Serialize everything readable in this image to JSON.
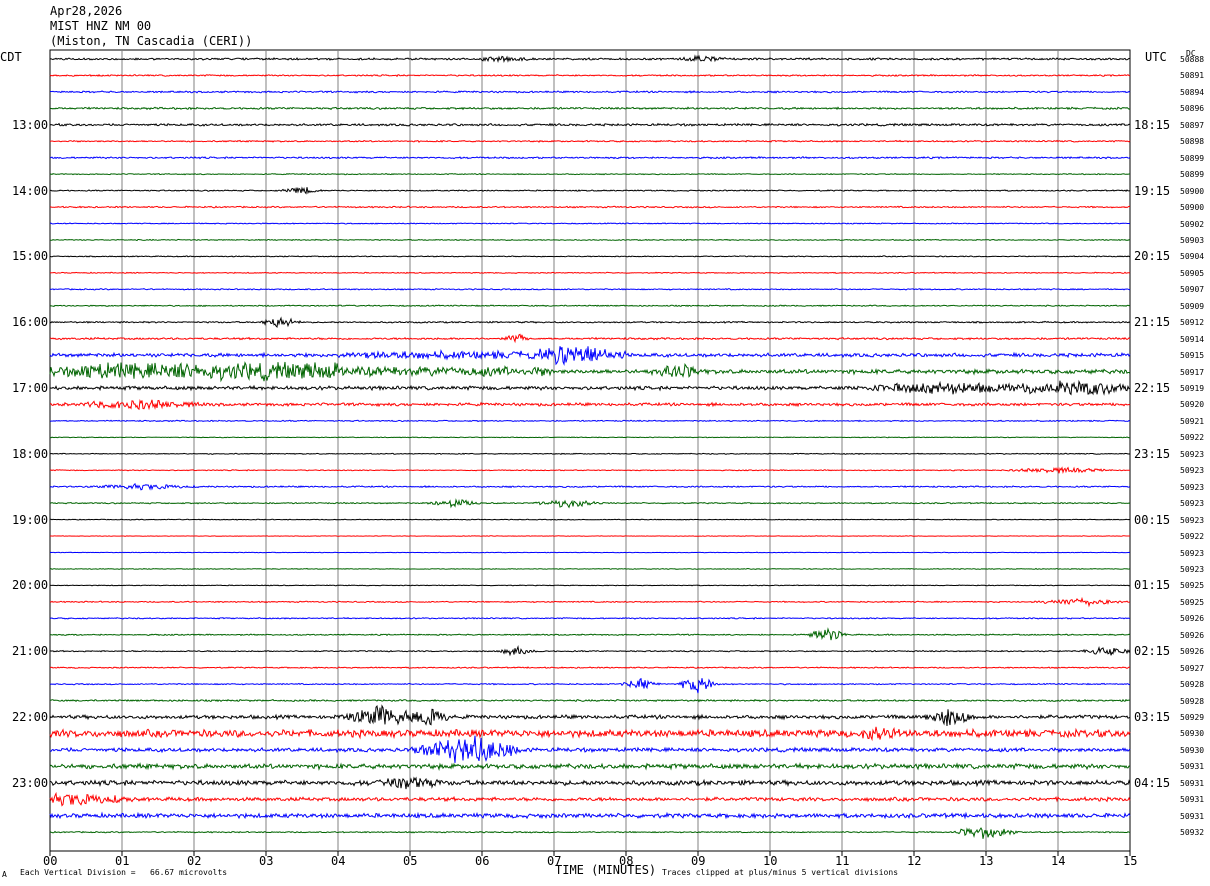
{
  "header": {
    "date": "Apr28,2026",
    "station": "MIST HNZ NM 00",
    "location": "(Miston, TN Cascadia (CERI))"
  },
  "axes": {
    "left_tz": "CDT",
    "right_tz": "UTC",
    "dc_label": "DC",
    "xlabel": "TIME (MINUTES)"
  },
  "footer": {
    "marker": "A",
    "scale_note": "Each Vertical Division =   66.67 microvolts",
    "clip_note": "Traces clipped at plus/minus 5 vertical divisions"
  },
  "colors": {
    "trace_cycle": [
      "#000000",
      "#ff0000",
      "#0000ff",
      "#006400"
    ],
    "grid": "#808080"
  },
  "chart_data": {
    "type": "line",
    "title": "",
    "x_range": [
      0,
      15
    ],
    "x_ticks": [
      "00",
      "01",
      "02",
      "03",
      "04",
      "05",
      "06",
      "07",
      "08",
      "09",
      "10",
      "11",
      "12",
      "13",
      "14",
      "15"
    ],
    "rows_per_hour": 4,
    "left_hour_labels": [
      {
        "row": 4,
        "label": "13:00"
      },
      {
        "row": 8,
        "label": "14:00"
      },
      {
        "row": 12,
        "label": "15:00"
      },
      {
        "row": 16,
        "label": "16:00"
      },
      {
        "row": 20,
        "label": "17:00"
      },
      {
        "row": 24,
        "label": "18:00"
      },
      {
        "row": 28,
        "label": "19:00"
      },
      {
        "row": 32,
        "label": "20:00"
      },
      {
        "row": 36,
        "label": "21:00"
      },
      {
        "row": 40,
        "label": "22:00"
      },
      {
        "row": 44,
        "label": "23:00"
      }
    ],
    "right_hour_labels": [
      {
        "row": 4,
        "label": "18:15"
      },
      {
        "row": 8,
        "label": "19:15"
      },
      {
        "row": 12,
        "label": "20:15"
      },
      {
        "row": 16,
        "label": "21:15"
      },
      {
        "row": 20,
        "label": "22:15"
      },
      {
        "row": 24,
        "label": "23:15"
      },
      {
        "row": 28,
        "label": "00:15"
      },
      {
        "row": 32,
        "label": "01:15"
      },
      {
        "row": 36,
        "label": "02:15"
      },
      {
        "row": 40,
        "label": "03:15"
      },
      {
        "row": 44,
        "label": "04:15"
      }
    ],
    "dc_values": [
      "50888",
      "50891",
      "50894",
      "50896",
      "50897",
      "50898",
      "50899",
      "50899",
      "50900",
      "50900",
      "50902",
      "50903",
      "50904",
      "50905",
      "50907",
      "50909",
      "50912",
      "50914",
      "50915",
      "50917",
      "50919",
      "50920",
      "50921",
      "50922",
      "50923",
      "50923",
      "50923",
      "50923",
      "50923",
      "50922",
      "50923",
      "50923",
      "50925",
      "50925",
      "50926",
      "50926",
      "50926",
      "50927",
      "50928",
      "50928",
      "50929",
      "50930",
      "50930",
      "50931",
      "50931",
      "50931",
      "50931",
      "50932"
    ],
    "row_noise_level": [
      0.8,
      0.6,
      0.7,
      0.8,
      0.9,
      0.6,
      0.7,
      0.4,
      0.5,
      0.6,
      0.4,
      0.4,
      0.4,
      0.4,
      0.5,
      0.5,
      0.6,
      0.8,
      2.5,
      4.5,
      1.5,
      1.2,
      0.5,
      0.3,
      0.4,
      0.4,
      0.6,
      0.5,
      0.3,
      0.2,
      0.2,
      0.3,
      0.3,
      0.5,
      0.5,
      0.5,
      0.5,
      0.5,
      0.5,
      0.7,
      1.5,
      3.0,
      2.0,
      2.0,
      2.0,
      1.5,
      1.8
    ],
    "events": [
      {
        "row": 0,
        "t": 6.3,
        "amp": 3,
        "dur": 0.4
      },
      {
        "row": 0,
        "t": 9.1,
        "amp": 3,
        "dur": 0.4
      },
      {
        "row": 8,
        "t": 3.5,
        "amp": 4,
        "dur": 0.3
      },
      {
        "row": 16,
        "t": 3.2,
        "amp": 7,
        "dur": 0.3
      },
      {
        "row": 17,
        "t": 6.5,
        "amp": 6,
        "dur": 0.2
      },
      {
        "row": 18,
        "t": 7.3,
        "amp": 12,
        "dur": 0.6
      },
      {
        "row": 19,
        "t": 8.7,
        "amp": 8,
        "dur": 0.4
      },
      {
        "row": 20,
        "t": 12.5,
        "amp": 6,
        "dur": 1.5
      },
      {
        "row": 20,
        "t": 14.3,
        "amp": 8,
        "dur": 1.0
      },
      {
        "row": 21,
        "t": 1.2,
        "amp": 5,
        "dur": 1.0
      },
      {
        "row": 25,
        "t": 14.0,
        "amp": 3,
        "dur": 0.8
      },
      {
        "row": 26,
        "t": 1.3,
        "amp": 3,
        "dur": 0.8
      },
      {
        "row": 27,
        "t": 5.6,
        "amp": 5,
        "dur": 0.4
      },
      {
        "row": 27,
        "t": 7.2,
        "amp": 5,
        "dur": 0.5
      },
      {
        "row": 33,
        "t": 14.3,
        "amp": 4,
        "dur": 0.7
      },
      {
        "row": 35,
        "t": 10.8,
        "amp": 9,
        "dur": 0.3
      },
      {
        "row": 36,
        "t": 6.5,
        "amp": 5,
        "dur": 0.3
      },
      {
        "row": 36,
        "t": 14.7,
        "amp": 5,
        "dur": 0.4
      },
      {
        "row": 38,
        "t": 9.0,
        "amp": 11,
        "dur": 0.3
      },
      {
        "row": 38,
        "t": 8.2,
        "amp": 6,
        "dur": 0.3
      },
      {
        "row": 40,
        "t": 4.6,
        "amp": 12,
        "dur": 0.6
      },
      {
        "row": 40,
        "t": 5.3,
        "amp": 10,
        "dur": 0.3
      },
      {
        "row": 40,
        "t": 12.5,
        "amp": 10,
        "dur": 0.4
      },
      {
        "row": 41,
        "t": 11.5,
        "amp": 6,
        "dur": 0.3
      },
      {
        "row": 42,
        "t": 5.8,
        "amp": 14,
        "dur": 0.8
      },
      {
        "row": 44,
        "t": 5.0,
        "amp": 6,
        "dur": 0.5
      },
      {
        "row": 45,
        "t": 0.3,
        "amp": 6,
        "dur": 1.0
      },
      {
        "row": 47,
        "t": 13.0,
        "amp": 8,
        "dur": 0.5
      }
    ]
  }
}
